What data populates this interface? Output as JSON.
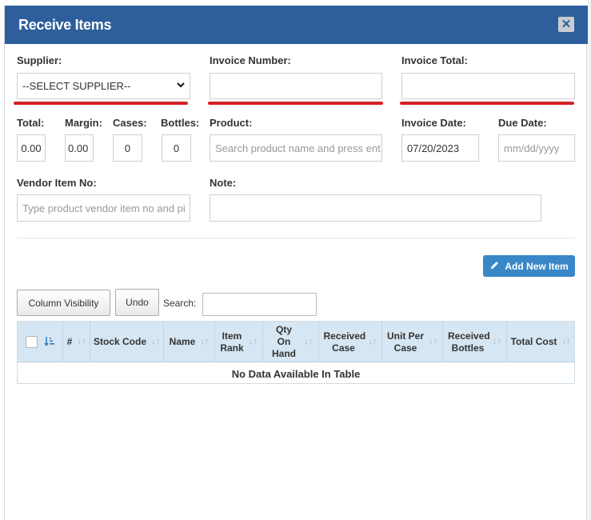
{
  "dialog": {
    "title": "Receive Items",
    "close_glyph": "✕"
  },
  "supplier": {
    "label": "Supplier:",
    "value": "--SELECT SUPPLIER--"
  },
  "invoice_number": {
    "label": "Invoice Number:",
    "value": ""
  },
  "invoice_total": {
    "label": "Invoice Total:",
    "value": ""
  },
  "total": {
    "label": "Total:",
    "value": "0.00"
  },
  "margin": {
    "label": "Margin:",
    "value": "0.00"
  },
  "cases": {
    "label": "Cases:",
    "value": "0"
  },
  "bottles": {
    "label": "Bottles:",
    "value": "0"
  },
  "product": {
    "label": "Product:",
    "placeholder": "Search product name and press ent"
  },
  "invoice_date": {
    "label": "Invoice Date:",
    "value": "07/20/2023"
  },
  "due_date": {
    "label": "Due Date:",
    "placeholder": "mm/dd/yyyy"
  },
  "vendor_item": {
    "label": "Vendor Item No:",
    "placeholder": "Type product vendor item no and pi"
  },
  "note": {
    "label": "Note:",
    "value": ""
  },
  "add_new_item": {
    "label": "Add New Item",
    "icon": "pencil-icon"
  },
  "toolbar": {
    "column_visibility": "Column Visibility",
    "undo": "Undo",
    "search_label": "Search:"
  },
  "table": {
    "columns": [
      "#",
      "Stock Code",
      "Name",
      "Item Rank",
      "Qty On Hand",
      "Received Case",
      "Unit Per Case",
      "Received Bottles",
      "Total Cost"
    ],
    "empty_message": "No Data Available In Table"
  },
  "colors": {
    "header": "#2e5f9c",
    "accent_button": "#3a87c8",
    "required_underline": "#d32026"
  }
}
